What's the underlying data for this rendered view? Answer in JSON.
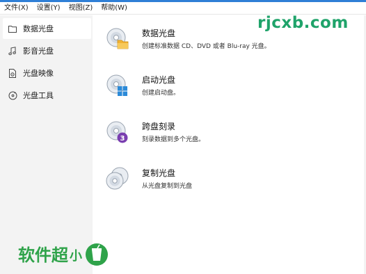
{
  "menu": [
    "文件(X)",
    "设置(Y)",
    "视图(Z)",
    "帮助(W)"
  ],
  "sidebar": {
    "items": [
      {
        "label": "数据光盘",
        "icon": "folder-icon",
        "active": true
      },
      {
        "label": "影音光盘",
        "icon": "music-note-icon",
        "active": false
      },
      {
        "label": "光盘映像",
        "icon": "disc-image-file-icon",
        "active": false
      },
      {
        "label": "光盘工具",
        "icon": "disc-tool-icon",
        "active": false
      }
    ]
  },
  "main": {
    "entries": [
      {
        "title": "数据光盘",
        "desc": "创建标准数据 CD、DVD 或者 Blu-ray 光盘。",
        "icon": "data-disc-icon"
      },
      {
        "title": "启动光盘",
        "desc": "创建启动盘。",
        "icon": "boot-disc-icon"
      },
      {
        "title": "跨盘刻录",
        "desc": "刻录数据到多个光盘。",
        "icon": "span-disc-icon",
        "badge": "3"
      },
      {
        "title": "复制光盘",
        "desc": "从光盘复制到光盘",
        "icon": "copy-disc-icon"
      }
    ]
  },
  "watermark": {
    "top": "rjcxb.com",
    "bottom_big": "软件超",
    "bottom_small": "小"
  },
  "colors": {
    "accent": "#2f7fd6",
    "sidebar_bg": "#f3f3f3",
    "watermark_green": "#1fa36a"
  }
}
